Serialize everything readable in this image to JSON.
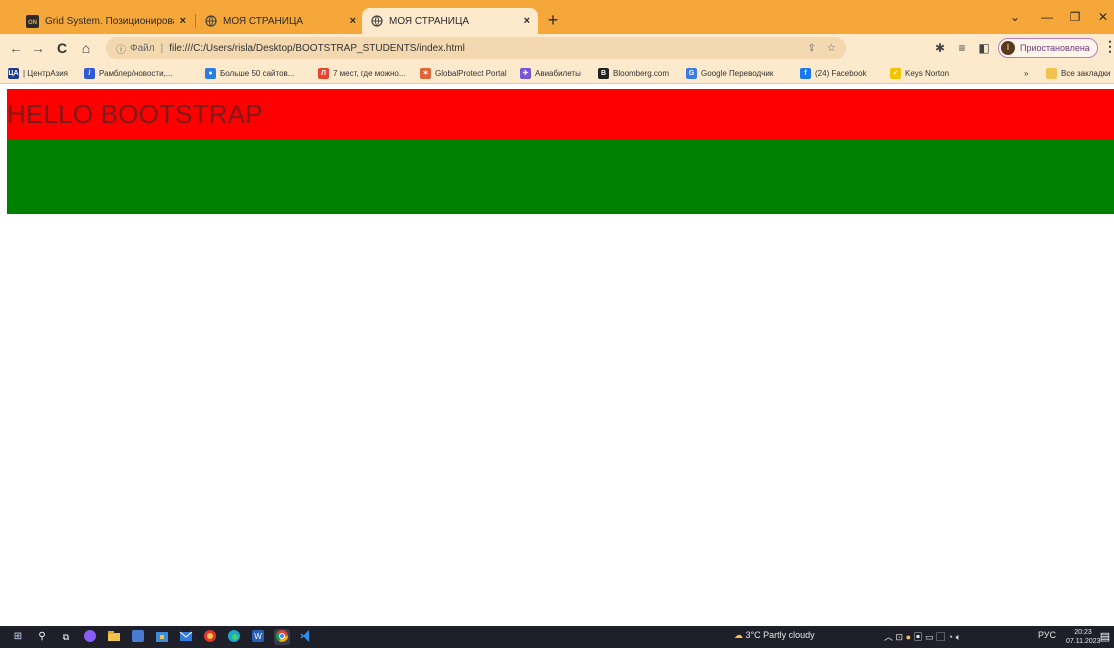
{
  "browser": {
    "tabs": [
      {
        "label": "Grid System. Позиционирован",
        "close": "×",
        "favicon": "on-logo-icon"
      },
      {
        "label": "МОЯ СТРАНИЦА",
        "close": "×",
        "favicon": "globe-icon"
      },
      {
        "label": "МОЯ СТРАНИЦА",
        "close": "×",
        "favicon": "globe-icon",
        "active": true
      }
    ],
    "new_tab": "+",
    "address": {
      "scheme_label": "Файл",
      "url": "file:///C:/Users/risla/Desktop/BOOTSTRAP_STUDENTS/index.html"
    },
    "profile_status": "Приостановлена",
    "profile_initial": "I",
    "bookmarks": [
      {
        "label": "| ЦентрАзия",
        "icon_text": "ЦА",
        "color": "#1a3a8a"
      },
      {
        "label": "Рамблер/новости,...",
        "icon_text": "/",
        "color": "#2d5bd6"
      },
      {
        "label": "Больше 50 сайтов...",
        "icon_text": "●",
        "color": "#2a7de1"
      },
      {
        "label": "7 мест, где можно...",
        "icon_text": "Л",
        "color": "#e8452c"
      },
      {
        "label": "GlobalProtect Portal",
        "icon_text": "✶",
        "color": "#e0663a"
      },
      {
        "label": "Авиабилеты",
        "icon_text": "✈",
        "color": "#7a55d6"
      },
      {
        "label": "Bloomberg.com",
        "icon_text": "B",
        "color": "#222222"
      },
      {
        "label": "Google Переводчик",
        "icon_text": "G",
        "color": "#3b7de8"
      },
      {
        "label": "(24) Facebook",
        "icon_text": "f",
        "color": "#1877f2"
      },
      {
        "label": "Keys Norton",
        "icon_text": "✓",
        "color": "#f2c400"
      }
    ],
    "bookmarks_overflow": "»",
    "all_bookmarks": "Все закладки"
  },
  "page": {
    "heading": "HELLO BOOTSTRAP",
    "colors": {
      "red_row": "#ff0000",
      "green_row": "#008000"
    }
  },
  "taskbar": {
    "weather": "3°C  Partly cloudy",
    "language": "РУС",
    "time": "20:23",
    "date": "07.11.2023"
  }
}
